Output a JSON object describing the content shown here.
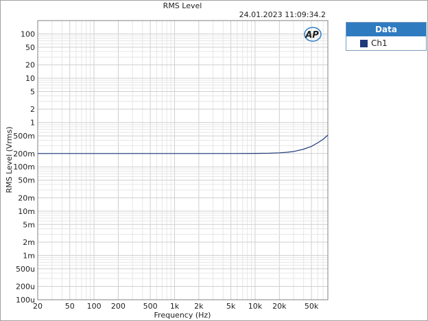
{
  "chart_data": {
    "type": "line",
    "title": "RMS Level",
    "timestamp": "24.01.2023 11:09:34.2",
    "xlabel": "Frequency (Hz)",
    "ylabel": "RMS Level (Vrms)",
    "xscale": "log",
    "yscale": "log",
    "xlim": [
      20,
      80000
    ],
    "ylim": [
      0.0001,
      200
    ],
    "grid": true,
    "legend_position": "right",
    "legend_title": "Data",
    "xticks": [
      {
        "v": 20,
        "label": "20"
      },
      {
        "v": 50,
        "label": "50"
      },
      {
        "v": 100,
        "label": "100"
      },
      {
        "v": 200,
        "label": "200"
      },
      {
        "v": 500,
        "label": "500"
      },
      {
        "v": 1000,
        "label": "1k"
      },
      {
        "v": 2000,
        "label": "2k"
      },
      {
        "v": 5000,
        "label": "5k"
      },
      {
        "v": 10000,
        "label": "10k"
      },
      {
        "v": 20000,
        "label": "20k"
      },
      {
        "v": 50000,
        "label": "50k"
      }
    ],
    "yticks": [
      {
        "v": 100,
        "label": "100"
      },
      {
        "v": 50,
        "label": "50"
      },
      {
        "v": 20,
        "label": "20"
      },
      {
        "v": 10,
        "label": "10"
      },
      {
        "v": 5,
        "label": "5"
      },
      {
        "v": 2,
        "label": "2"
      },
      {
        "v": 1,
        "label": "1"
      },
      {
        "v": 0.5,
        "label": "500m"
      },
      {
        "v": 0.2,
        "label": "200m"
      },
      {
        "v": 0.1,
        "label": "100m"
      },
      {
        "v": 0.05,
        "label": "50m"
      },
      {
        "v": 0.02,
        "label": "20m"
      },
      {
        "v": 0.01,
        "label": "10m"
      },
      {
        "v": 0.005,
        "label": "5m"
      },
      {
        "v": 0.002,
        "label": "2m"
      },
      {
        "v": 0.001,
        "label": "1m"
      },
      {
        "v": 0.0005,
        "label": "500u"
      },
      {
        "v": 0.0002,
        "label": "200u"
      },
      {
        "v": 0.0001,
        "label": "100u"
      }
    ],
    "series": [
      {
        "name": "Ch1",
        "color": "#1f3a7a",
        "x": [
          20,
          100,
          1000,
          5000,
          10000,
          15000,
          20000,
          25000,
          30000,
          40000,
          50000,
          60000,
          70000,
          80000
        ],
        "y": [
          0.2,
          0.2,
          0.2,
          0.2,
          0.201,
          0.203,
          0.207,
          0.213,
          0.222,
          0.25,
          0.29,
          0.35,
          0.42,
          0.52
        ]
      }
    ]
  },
  "logo": {
    "text": "AP"
  }
}
